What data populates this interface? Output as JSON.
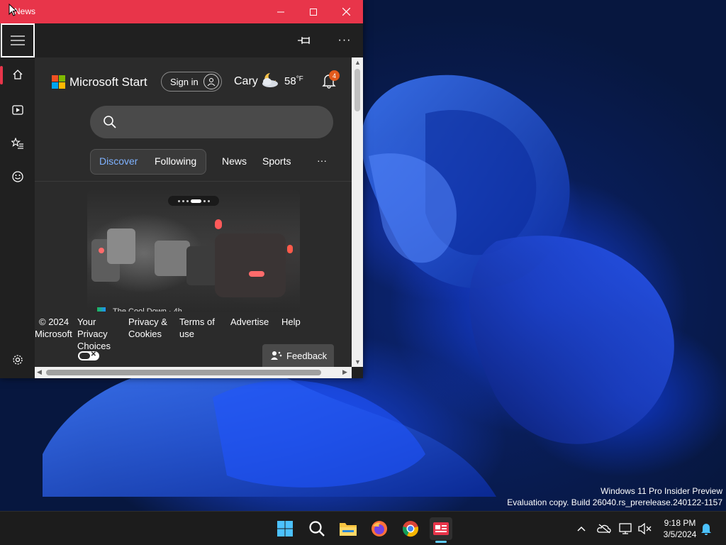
{
  "window": {
    "title": "News",
    "minimize_label": "–",
    "maximize_label": "☐",
    "close_label": "✕"
  },
  "appbar": {
    "menu_icon": "hamburger-icon",
    "pin_icon": "pin-icon",
    "more_label": "···"
  },
  "left_rail": {
    "items": [
      {
        "icon": "home-icon",
        "active": true
      },
      {
        "icon": "video-icon",
        "active": false
      },
      {
        "icon": "starred-list-icon",
        "active": false
      },
      {
        "icon": "smiley-icon",
        "active": false
      }
    ],
    "settings_icon": "gear-icon"
  },
  "header": {
    "brand": "Microsoft Start",
    "signin_label": "Sign in",
    "weather_city": "Cary",
    "weather_icon": "partly-cloudy-night-icon",
    "weather_temp": "58",
    "weather_unit": "°F",
    "notification_count": "4",
    "overflow_label": "⋮"
  },
  "search": {
    "placeholder": "",
    "value": ""
  },
  "tabs": {
    "discover": "Discover",
    "following": "Following",
    "news": "News",
    "sports": "Sports",
    "more": "···"
  },
  "hero": {
    "source": "The Cool Down · 4h",
    "slide_count": 6,
    "active_slide": 4
  },
  "footer": {
    "copyright_line1": "© 2024",
    "copyright_line2": "Microsoft",
    "privacy_line1": "Your",
    "privacy_line2": "Privacy",
    "privacy_line3": "Choices",
    "cookies_line1": "Privacy &",
    "cookies_line2": "Cookies",
    "terms_line1": "Terms of",
    "terms_line2": "use",
    "advertise": "Advertise",
    "help": "Help",
    "feedback": "Feedback"
  },
  "watermark": {
    "line1": "Windows 11 Pro Insider Preview",
    "line2": "Evaluation copy. Build 26040.rs_prerelease.240122-1157"
  },
  "taskbar": {
    "apps": [
      "windows-start-icon",
      "search-icon",
      "file-explorer-icon",
      "firefox-icon",
      "chrome-icon",
      "news-app-icon"
    ],
    "tray": [
      "chevron-up-icon",
      "onedrive-offline-icon",
      "network-icon",
      "volume-muted-icon",
      "notification-bell-icon"
    ],
    "time": "9:18 PM",
    "date": "3/5/2024"
  },
  "colors": {
    "title_bar": "#e8354a",
    "accent_tab": "#7fb2ff",
    "badge": "#e25a1c",
    "taskbar_indicator": "#60cdff"
  }
}
